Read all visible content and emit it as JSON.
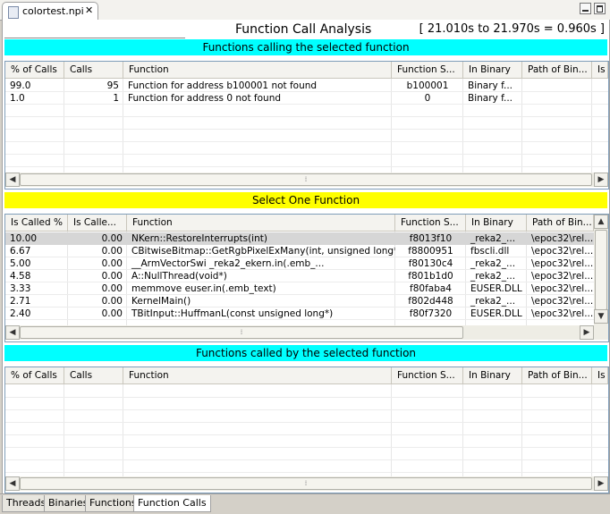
{
  "editor_tab": {
    "title": "colortest.npi",
    "close": "✕"
  },
  "window_controls": {
    "minimize": "minimize-icon",
    "maximize": "maximize-icon"
  },
  "header": {
    "title": "Function Call Analysis",
    "range": "[ 21.010s to 21.970s = 0.960s ]"
  },
  "callers": {
    "band": "Functions calling the selected function",
    "columns": [
      "% of Calls",
      "Calls",
      "Function",
      "Function S...",
      "In Binary",
      "Path of Bin...",
      "Is"
    ],
    "rows": [
      [
        "99.0",
        "95",
        "Function for address b100001 not found",
        "b100001",
        "Binary f...",
        ""
      ],
      [
        "1.0",
        "1",
        "Function for address 0 not found",
        "0",
        "Binary f...",
        ""
      ]
    ]
  },
  "select": {
    "band": "Select One Function",
    "columns": [
      "Is Called %",
      "Is Calle...",
      "Function",
      "Function S...",
      "In Binary",
      "Path of Bin..."
    ],
    "rows": [
      [
        "10.00",
        "0.00",
        "NKern::RestoreInterrupts(int)",
        "f8013f10",
        "_reka2_...",
        "\\epoc32\\rel..."
      ],
      [
        "6.67",
        "0.00",
        "CBitwiseBitmap::GetRgbPixelExMany(int, unsigned long*,...",
        "f8800951",
        "fbscli.dll",
        "\\epoc32\\rel..."
      ],
      [
        "5.00",
        "0.00",
        "__ArmVectorSwi                    _reka2_ekern.in(.emb_...",
        "f80130c4",
        "_reka2_...",
        "\\epoc32\\rel..."
      ],
      [
        "4.58",
        "0.00",
        "A::NullThread(void*)",
        "f801b1d0",
        "_reka2_...",
        "\\epoc32\\rel..."
      ],
      [
        "3.33",
        "0.00",
        "memmove                              euser.in(.emb_text)",
        "f80faba4",
        "EUSER.DLL",
        "\\epoc32\\rel..."
      ],
      [
        "2.71",
        "0.00",
        "KernelMain()",
        "f802d448",
        "_reka2_...",
        "\\epoc32\\rel..."
      ],
      [
        "2.40",
        "0.00",
        "TBitInput::HuffmanL(const unsigned long*)",
        "f80f7320",
        "EUSER.DLL",
        "\\epoc32\\rel..."
      ]
    ]
  },
  "callees": {
    "band": "Functions called by the selected function",
    "columns": [
      "% of Calls",
      "Calls",
      "Function",
      "Function S...",
      "In Binary",
      "Path of Bin...",
      "Is"
    ],
    "rows": []
  },
  "bottom_tabs": [
    "Threads",
    "Binaries",
    "Functions",
    "Function Calls"
  ],
  "active_bottom_tab": "Function Calls",
  "colors": {
    "cyan_band": "#00ffff",
    "yellow_band": "#ffff00",
    "selected_row": "#d6d6d6"
  }
}
